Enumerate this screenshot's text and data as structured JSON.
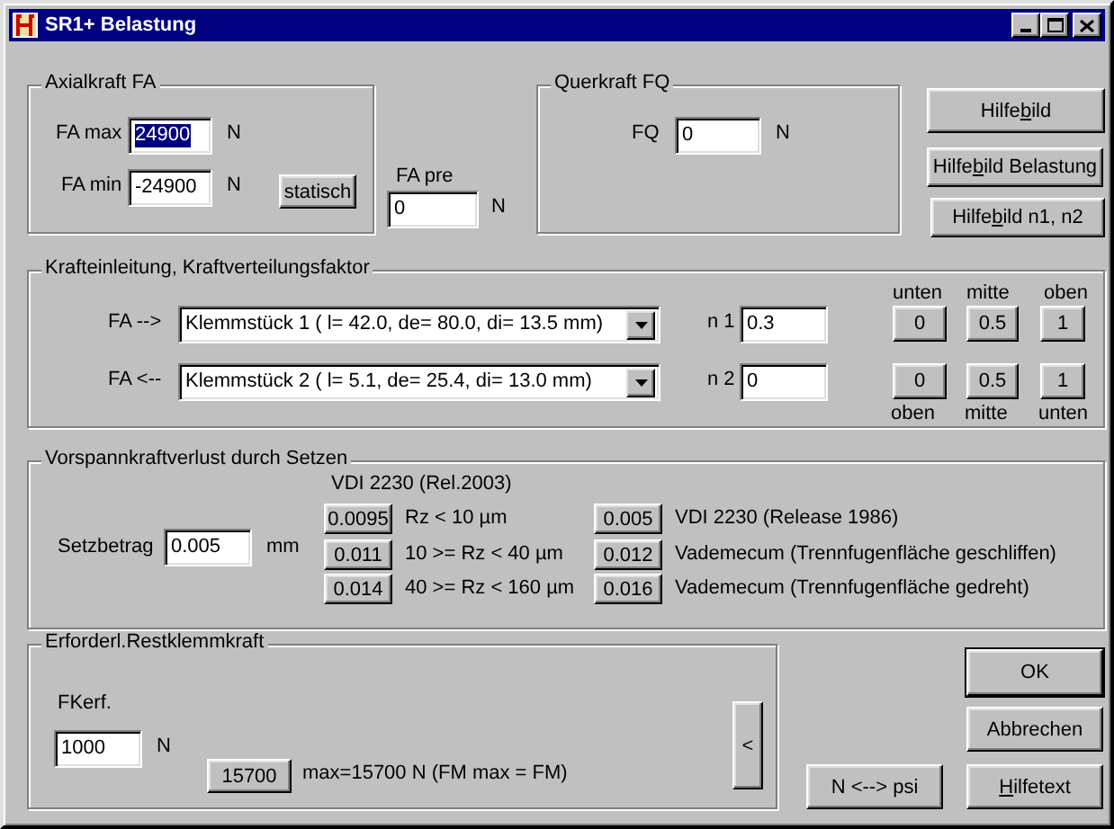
{
  "window": {
    "title": "SR1+ Belastung"
  },
  "axial": {
    "title": "Axialkraft FA",
    "button": "statisch",
    "fields": [
      {
        "label": "FA max",
        "value": "24900",
        "unit": "N",
        "selected": true
      },
      {
        "label": "FA min",
        "value": "-24900",
        "unit": "N",
        "selected": false
      }
    ]
  },
  "fa_pre": {
    "label": "FA pre",
    "value": "0",
    "unit": "N"
  },
  "querkraft": {
    "title": "Querkraft FQ",
    "label": "FQ",
    "value": "0",
    "unit": "N"
  },
  "help_buttons": [
    {
      "label_start": "Hilfe",
      "mnemonic": "b",
      "label_end": "ild"
    },
    {
      "label_start": "Hilfe",
      "mnemonic": "b",
      "label_end": "ild Belastung"
    },
    {
      "label_start": "Hilfe",
      "mnemonic": "b",
      "label_end": "ild n1, n2"
    }
  ],
  "krafteinleitung": {
    "title": "Krafteinleitung, Kraftverteilungsfaktor",
    "top_labels": [
      "unten",
      "mitte",
      "oben"
    ],
    "bottom_labels": [
      "oben",
      "mitte",
      "unten"
    ],
    "rows": [
      {
        "label": "FA  -->",
        "combo": "Klemmstück 1  ( l= 42.0, de= 80.0, di= 13.5 mm)",
        "n_label": "n 1",
        "n_value": "0.3",
        "buttons": [
          "0",
          "0.5",
          "1"
        ]
      },
      {
        "label": "FA  <--",
        "combo": "Klemmstück 2  ( l= 5.1, de= 25.4, di= 13.0 mm)",
        "n_label": "n 2",
        "n_value": "0",
        "buttons": [
          "0",
          "0.5",
          "1"
        ]
      }
    ]
  },
  "setzen": {
    "title": "Vorspannkraftverlust durch Setzen",
    "subtitle": "VDI 2230 (Rel.2003)",
    "label": "Setzbetrag",
    "value": "0.005",
    "unit": "mm",
    "columns": [
      [
        {
          "button": "0.0095",
          "text": "Rz < 10 µm"
        },
        {
          "button": "0.011",
          "text": "10 >= Rz < 40 µm"
        },
        {
          "button": "0.014",
          "text": "40 >= Rz < 160 µm"
        }
      ],
      [
        {
          "button": "0.005",
          "text": "VDI 2230 (Release 1986)"
        },
        {
          "button": "0.012",
          "text": "Vademecum (Trennfugenfläche geschliffen)"
        },
        {
          "button": "0.016",
          "text": "Vademecum (Trennfugenfläche gedreht)"
        }
      ]
    ]
  },
  "restklemmkraft": {
    "title": "Erforderl.Restklemmkraft",
    "label": "FKerf.",
    "value": "1000",
    "unit": "N",
    "button": "15700",
    "note": "max=15700 N  (FM max = FM)",
    "side_button": "<"
  },
  "buttons": [
    {
      "label": "OK",
      "default": true
    },
    {
      "label": "Abbrechen",
      "default": false
    },
    {
      "label": "N <--> psi",
      "default": false
    },
    {
      "mnemonic": "H",
      "label_end": "ilfetext",
      "default": false
    }
  ]
}
